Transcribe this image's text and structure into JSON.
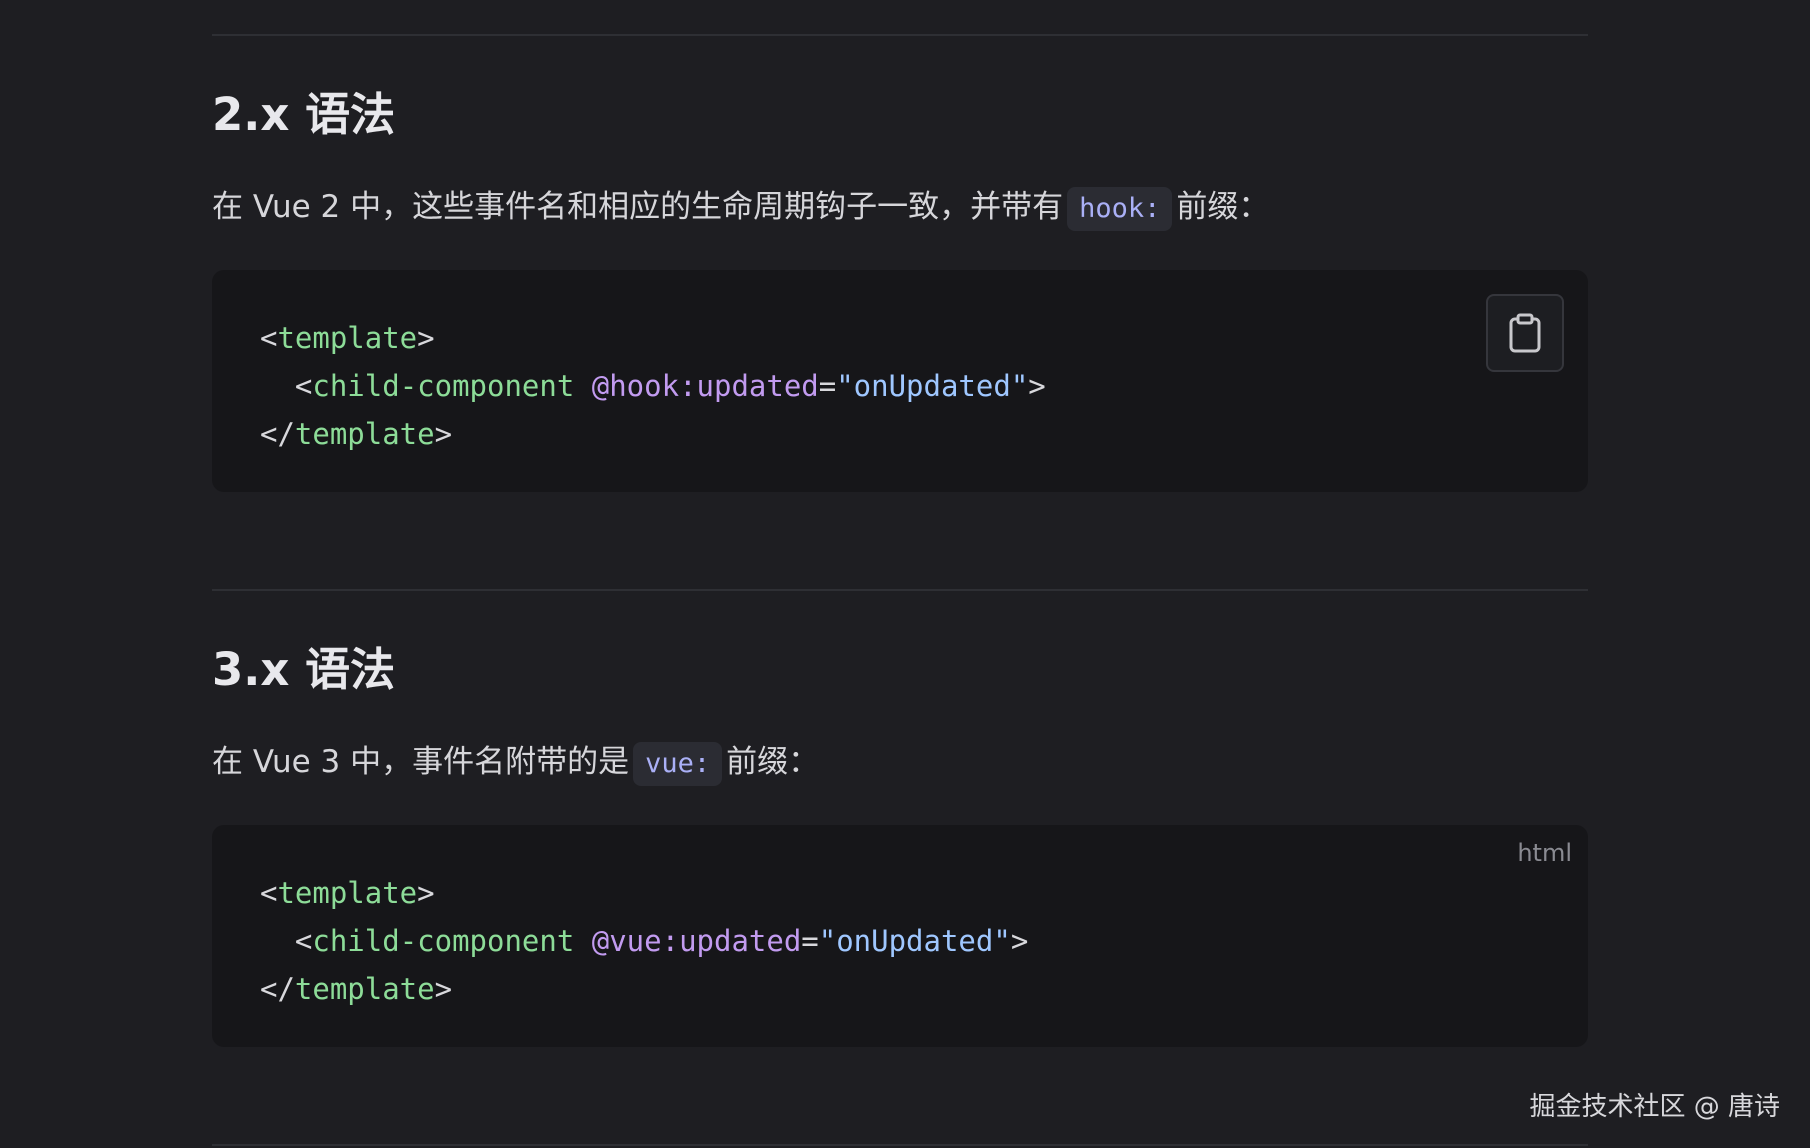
{
  "section_2x": {
    "heading": "2.x 语法",
    "text_before": "在 Vue 2 中，这些事件名和相应的生命周期钩子一致，并带有",
    "inline_code": "hook:",
    "text_after": "前缀："
  },
  "code_2x": {
    "line1": {
      "open": "<",
      "tag": "template",
      "close": ">"
    },
    "line2": {
      "indent": "  ",
      "open": "<",
      "tag": "child-component",
      "space": " ",
      "attr": "@hook:updated",
      "eq": "=",
      "value": "\"onUpdated\"",
      "close": ">"
    },
    "line3": {
      "open": "</",
      "tag": "template",
      "close": ">"
    },
    "copy_icon": "clipboard-icon"
  },
  "section_3x": {
    "heading": "3.x 语法",
    "text_before": "在 Vue 3 中，事件名附带的是",
    "inline_code": "vue:",
    "text_after": "前缀："
  },
  "code_3x": {
    "lang": "html",
    "line1": {
      "open": "<",
      "tag": "template",
      "close": ">"
    },
    "line2": {
      "indent": "  ",
      "open": "<",
      "tag": "child-component",
      "space": " ",
      "attr": "@vue:updated",
      "eq": "=",
      "value": "\"onUpdated\"",
      "close": ">"
    },
    "line3": {
      "open": "</",
      "tag": "template",
      "close": ">"
    }
  },
  "watermark": "掘金技术社区 @ 唐诗",
  "colors": {
    "background": "#1e1e22",
    "code_background": "#161619",
    "tag": "#8ddc98",
    "attribute": "#c29bf0",
    "string": "#9fc7ff",
    "inline_code": "#aab0f6"
  }
}
